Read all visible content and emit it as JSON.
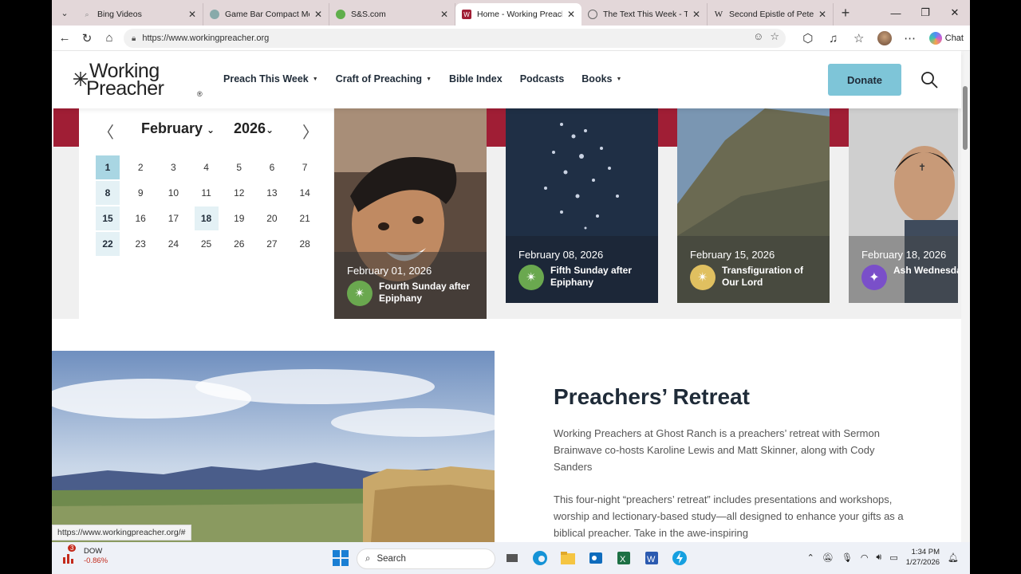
{
  "browser": {
    "tabs": [
      {
        "label": "Bing Videos",
        "favicon": "search-icon",
        "active": false
      },
      {
        "label": "Game Bar Compact Mode",
        "favicon": "game-bar-icon",
        "active": false
      },
      {
        "label": "S&S.com",
        "favicon": "leaf-icon",
        "active": false
      },
      {
        "label": "Home - Working Preacher",
        "favicon": "working-preacher-icon",
        "active": true
      },
      {
        "label": "The Text This Week - Textweek",
        "favicon": "globe-icon",
        "active": false
      },
      {
        "label": "Second Epistle of Peter - Wikipedia",
        "favicon": "wikipedia-icon",
        "active": false
      }
    ],
    "url": "https://www.workingpreacher.org",
    "chat_label": "Chat"
  },
  "site": {
    "logo": {
      "line1": "Working",
      "line2": "Preacher",
      "reg": "®"
    },
    "nav": [
      {
        "label": "Preach This Week",
        "dropdown": true
      },
      {
        "label": "Craft of Preaching",
        "dropdown": true
      },
      {
        "label": "Bible Index",
        "dropdown": false
      },
      {
        "label": "Podcasts",
        "dropdown": false
      },
      {
        "label": "Books",
        "dropdown": true
      }
    ],
    "donate_label": "Donate"
  },
  "calendar": {
    "month": "February",
    "year": "2026",
    "weeks": [
      [
        "1",
        "2",
        "3",
        "4",
        "5",
        "6",
        "7"
      ],
      [
        "8",
        "9",
        "10",
        "11",
        "12",
        "13",
        "14"
      ],
      [
        "15",
        "16",
        "17",
        "18",
        "19",
        "20",
        "21"
      ],
      [
        "22",
        "23",
        "24",
        "25",
        "26",
        "27",
        "28"
      ]
    ],
    "selected_day": "1",
    "highlighted_day": "18"
  },
  "cards": [
    {
      "date": "February 01, 2026",
      "title": "Fourth Sunday after Epiphany",
      "badge_color": "#6aa84f",
      "icon": "star-burst-icon"
    },
    {
      "date": "February 08, 2026",
      "title": "Fifth Sunday after Epiphany",
      "badge_color": "#6aa84f",
      "icon": "star-burst-icon"
    },
    {
      "date": "February 15, 2026",
      "title": "Transfiguration of Our Lord",
      "badge_color": "#e0c060",
      "icon": "star-burst-icon"
    },
    {
      "date": "February 18, 2026",
      "title": "Ash Wednesday",
      "badge_color": "#7a4fc9",
      "icon": "four-point-star-icon"
    }
  ],
  "retreat": {
    "title": "Preachers’ Retreat",
    "para1": "Working Preachers at Ghost Ranch is a preachers’ retreat with Sermon Brainwave co-hosts Karoline Lewis and Matt Skinner, along with Cody Sanders",
    "para2": "This four-night “preachers’ retreat” includes presentations and workshops, worship and lectionary-based study—all designed to enhance your gifts as a biblical preacher. Take in the awe-inspiring"
  },
  "status_url": "https://www.workingpreacher.org/#",
  "taskbar": {
    "widget_badge": "3",
    "widget_name": "DOW",
    "widget_change": "-0.86%",
    "search_label": "Search",
    "time": "1:34 PM",
    "date": "1/27/2026"
  },
  "colors": {
    "accent_maroon": "#a01e35",
    "donate_blue": "#7ec5d8",
    "calendar_highlight": "#e4f1f5"
  }
}
